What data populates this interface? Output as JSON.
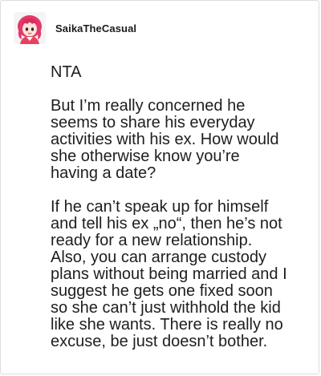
{
  "post": {
    "author": "SaikaTheCasual",
    "avatar_icon": "anime-character-avatar",
    "paragraphs": [
      "NTA",
      "But I’m really concerned he seems to share his everyday activities with his ex. How would she otherwise know you’re having a date?",
      "If he can’t speak up for himself and tell his ex „no“, then he’s not ready for a new relationship. Also, you can arrange custody plans without being married and I suggest he gets one fixed soon so she can’t just withhold the kid like she wants. There is really no excuse, be just doesn’t bother."
    ]
  },
  "colors": {
    "avatar_pink": "#e8415f",
    "avatar_hair": "#e23a6a",
    "text": "#1e1e1e",
    "border": "#dcdcdc"
  }
}
